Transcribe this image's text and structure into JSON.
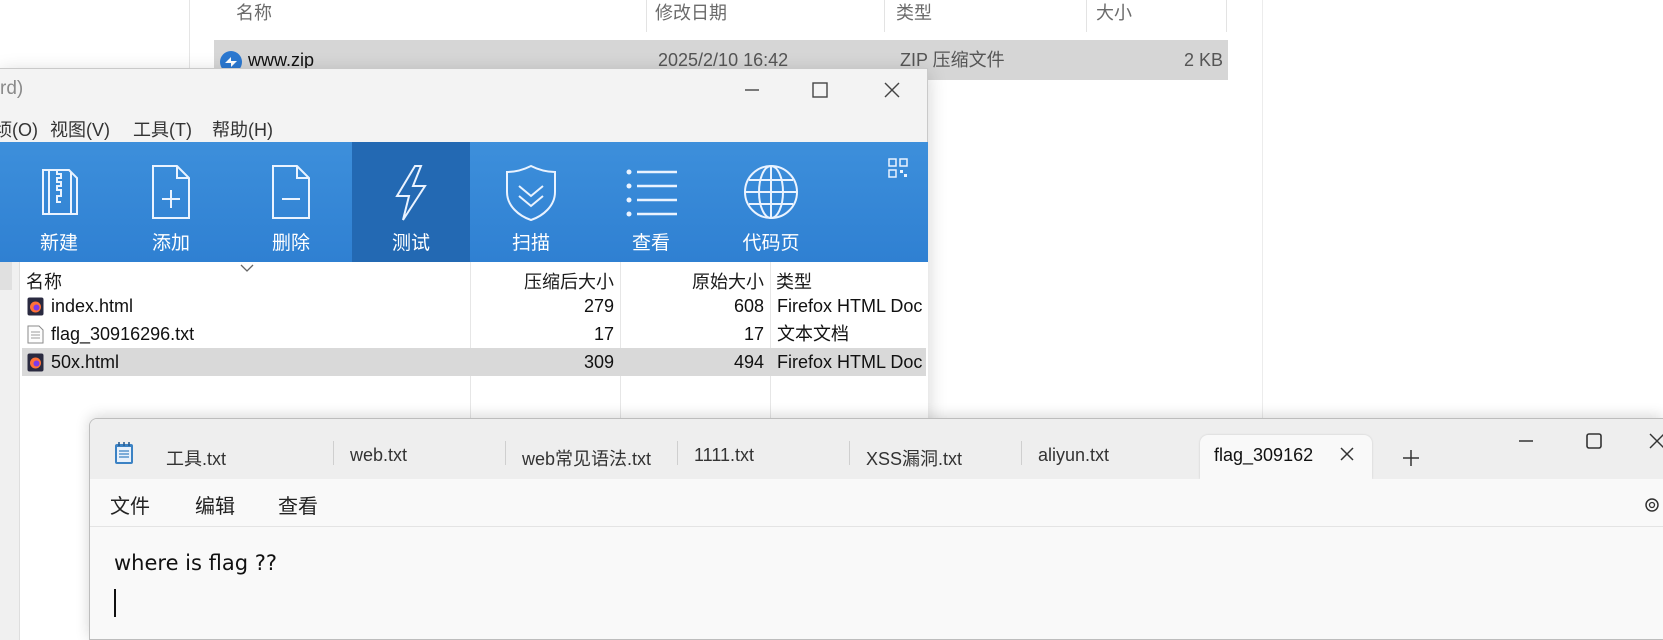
{
  "explorer": {
    "columns": [
      "名称",
      "修改日期",
      "类型",
      "大小"
    ],
    "row": {
      "name": "www.zip",
      "modified": "2025/2/10 16:42",
      "type": "ZIP 压缩文件",
      "size": "2 KB"
    }
  },
  "archive": {
    "title_fragment": "rd)",
    "menu": [
      "顷(O)",
      "视图(V)",
      "工具(T)",
      "帮助(H)"
    ],
    "toolbar": [
      {
        "label": "新建",
        "icon": "zip-archive-icon"
      },
      {
        "label": "添加",
        "icon": "add-file-icon"
      },
      {
        "label": "删除",
        "icon": "delete-file-icon"
      },
      {
        "label": "测试",
        "icon": "lightning-icon"
      },
      {
        "label": "扫描",
        "icon": "shield-scan-icon"
      },
      {
        "label": "查看",
        "icon": "list-view-icon"
      },
      {
        "label": "代码页",
        "icon": "globe-icon"
      }
    ],
    "active_toolbar_index": 3,
    "columns": {
      "name": "名称",
      "compressed": "压缩后大小",
      "original": "原始大小",
      "type": "类型"
    },
    "files": [
      {
        "name": "index.html",
        "compressed": "279",
        "original": "608",
        "type": "Firefox HTML Doc",
        "icon": "firefox-html-icon"
      },
      {
        "name": "flag_30916296.txt",
        "compressed": "17",
        "original": "17",
        "type": "文本文档",
        "icon": "text-file-icon"
      },
      {
        "name": "50x.html",
        "compressed": "309",
        "original": "494",
        "type": "Firefox HTML Doc",
        "icon": "firefox-html-icon"
      }
    ],
    "selected_file_index": 2,
    "colors": {
      "toolbar": "#3388d6",
      "toolbar_active": "#2369b3"
    }
  },
  "notepad": {
    "tabs": [
      {
        "label": "工具.txt"
      },
      {
        "label": "web.txt"
      },
      {
        "label": "web常见语法.txt"
      },
      {
        "label": "1111.txt"
      },
      {
        "label": "XSS漏洞.txt"
      },
      {
        "label": "aliyun.txt"
      },
      {
        "label": "flag_309162"
      }
    ],
    "active_tab_index": 6,
    "menu": [
      "文件",
      "编辑",
      "查看"
    ],
    "content": "where is flag ??"
  }
}
